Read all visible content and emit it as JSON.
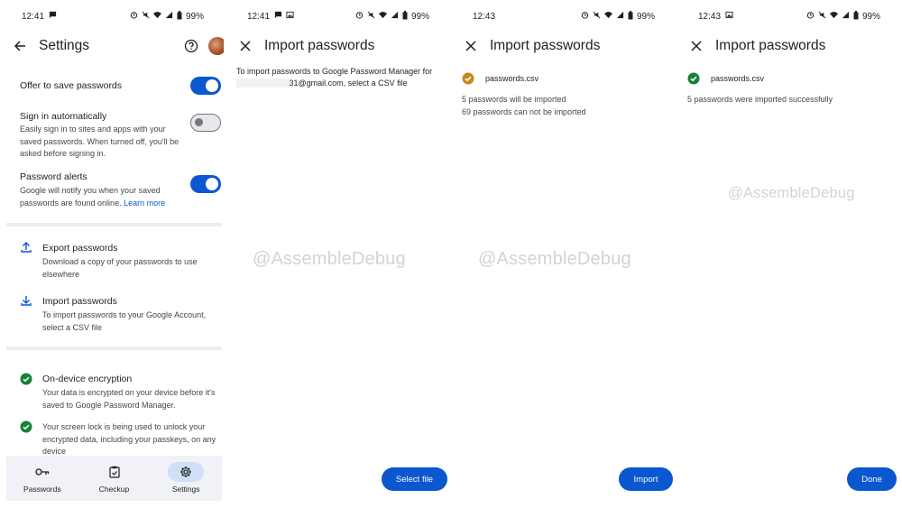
{
  "panels": [
    {
      "status": {
        "time": "12:41",
        "battery": "99%"
      },
      "title": "Settings",
      "settings": [
        {
          "title": "Offer to save passwords",
          "toggle": "on"
        },
        {
          "title": "Sign in automatically",
          "subtitle": "Easily sign in to sites and apps with your saved passwords. When turned off, you'll be asked before signing in.",
          "toggle": "off"
        },
        {
          "title": "Password alerts",
          "subtitle": "Google will notify you when your saved passwords are found online.",
          "link": "Learn more",
          "toggle": "on"
        }
      ],
      "export": {
        "title": "Export passwords",
        "subtitle": "Download a copy of your passwords to use elsewhere",
        "icon": "upload-icon"
      },
      "import": {
        "title": "Import passwords",
        "subtitle": "To import passwords to your Google Account, select a CSV file",
        "icon": "download-icon"
      },
      "encryption": [
        {
          "title": "On-device encryption",
          "subtitle": "Your data is encrypted on your device before it's saved to Google Password Manager."
        },
        {
          "subtitle": "Your screen lock is being used to unlock your encrypted data, including your passkeys, on any device"
        }
      ],
      "nav": [
        {
          "label": "Passwords",
          "icon": "key-icon"
        },
        {
          "label": "Checkup",
          "icon": "clipboard-check-icon"
        },
        {
          "label": "Settings",
          "icon": "gear-icon",
          "active": true
        }
      ]
    },
    {
      "status": {
        "time": "12:41",
        "battery": "99%"
      },
      "title": "Import passwords",
      "intro_line1": "To import passwords to Google Password Manager for",
      "intro_email": "31@gmail.com, select a CSV file",
      "button": "Select file",
      "watermark": "@AssembleDebug"
    },
    {
      "status": {
        "time": "12:43",
        "battery": "99%"
      },
      "title": "Import passwords",
      "file": "passwords.csv",
      "line1": "5 passwords will be imported",
      "line2": "69 passwords can not be imported",
      "button": "Import",
      "watermark": "@AssembleDebug"
    },
    {
      "status": {
        "time": "12:43",
        "battery": "99%"
      },
      "title": "Import passwords",
      "file": "passwords.csv",
      "line1": "5 passwords were imported successfully",
      "button": "Done",
      "watermark": "@AssembleDebug"
    }
  ],
  "colors": {
    "accent": "#0b57d0",
    "success": "#188038",
    "warning": "#c58a1c",
    "navBg": "#f0f2f8"
  }
}
